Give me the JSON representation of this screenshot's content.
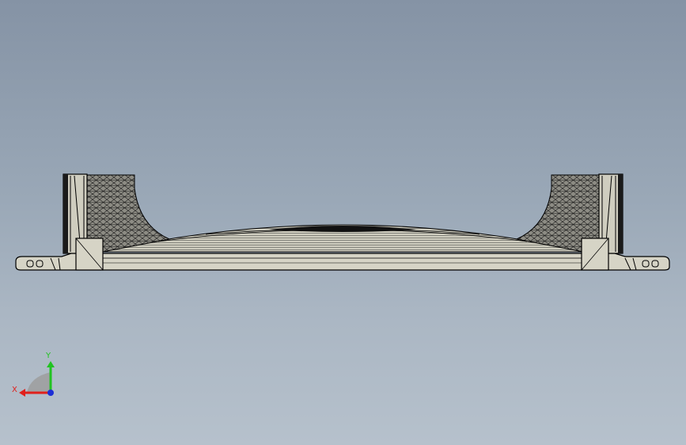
{
  "viewport": {
    "background_top": "#8593a5",
    "background_bottom": "#b6c1cc"
  },
  "model": {
    "face_color": "#d6d4c6",
    "edge_color": "#000000"
  },
  "triad": {
    "x_label": "X",
    "y_label": "Y",
    "x_color": "#e0201c",
    "y_color": "#21c321",
    "z_color": "#1b2ed6",
    "plane_color": "#9e9e9e"
  }
}
